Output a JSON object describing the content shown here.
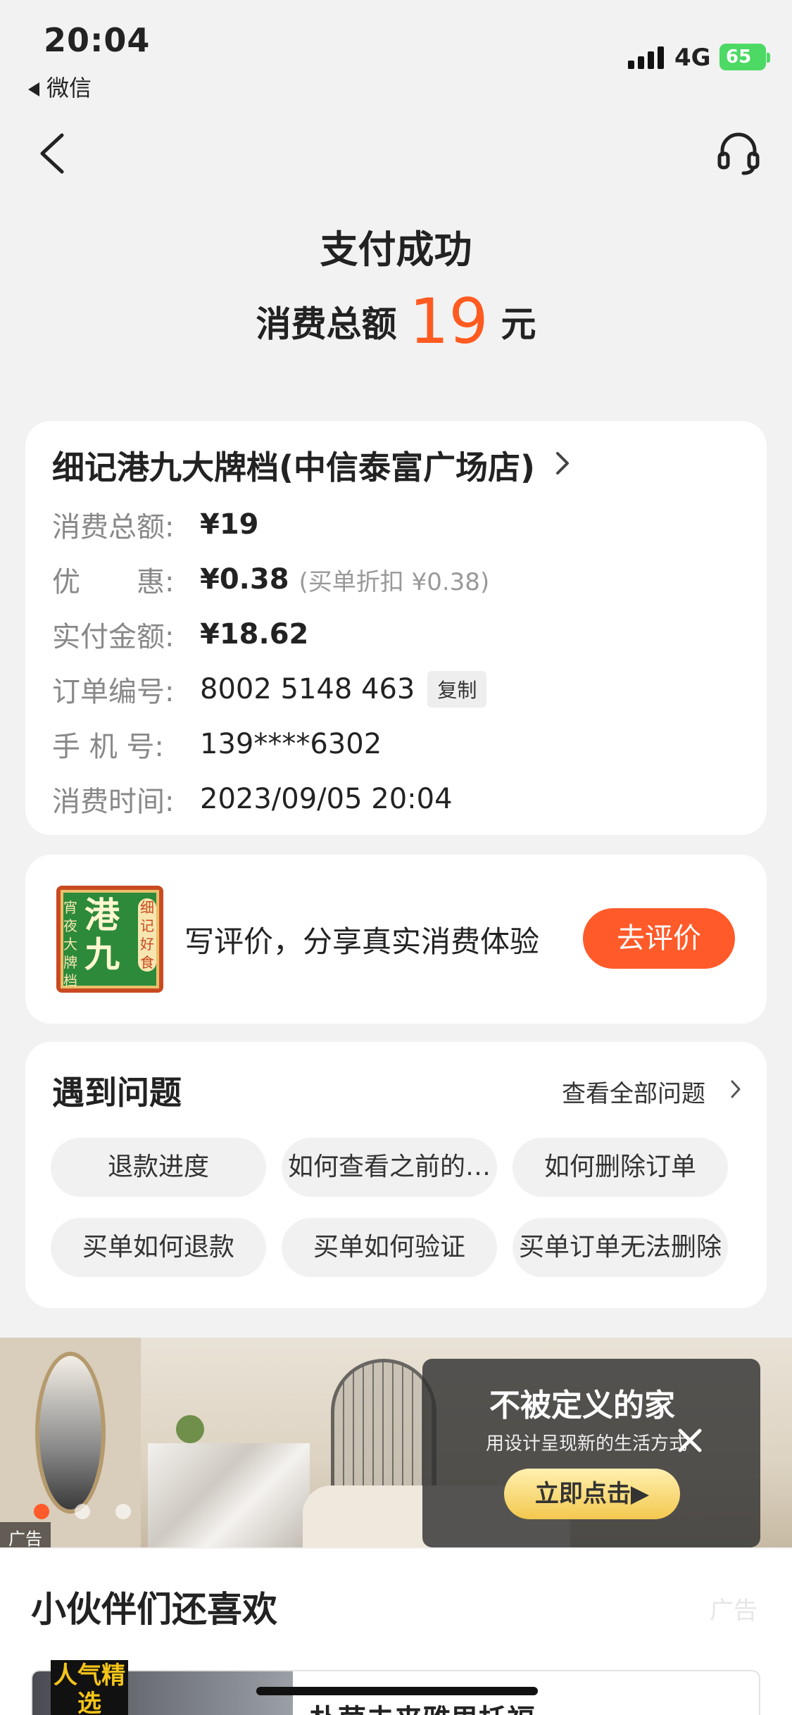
{
  "status_bar": {
    "time": "20:04",
    "back_app": "微信",
    "network": "4G",
    "battery": "65"
  },
  "header": {
    "title": "支付成功",
    "total_label": "消费总额",
    "total_amount": "19",
    "total_unit": "元"
  },
  "order": {
    "shop_name": "细记港九大牌档(中信泰富广场店)",
    "rows": [
      {
        "key": "消费总额:",
        "value": "¥19"
      },
      {
        "key": "优　　惠:",
        "value": "¥0.38",
        "note": "(买单折扣 ¥0.38)"
      },
      {
        "key": "实付金额:",
        "value": "¥18.62"
      },
      {
        "key": "订单编号:",
        "value": "8002 5148 463",
        "action": "复制"
      },
      {
        "key": "手 机 号:",
        "value": "139****6302"
      },
      {
        "key": "消费时间:",
        "value": "2023/09/05 20:04"
      }
    ]
  },
  "review": {
    "logo_text": "港九",
    "logo_side_left": "宵夜大牌档",
    "logo_side_right": "细记好食",
    "prompt": "写评价，分享真实消费体验",
    "button": "去评价"
  },
  "faq": {
    "title": "遇到问题",
    "view_all": "查看全部问题",
    "chips": [
      "退款进度",
      "如何查看之前的…",
      "如何删除订单",
      "买单如何退款",
      "买单如何验证",
      "买单订单无法删除"
    ]
  },
  "ad": {
    "headline": "不被定义的家",
    "subline": "用设计呈现新的生活方式",
    "cta": "立即点击▶",
    "tag": "广告",
    "active_slide": 1,
    "slide_count": 3
  },
  "recommend": {
    "title": "小伙伴们还喜欢",
    "ad_label": "广告",
    "badge": "人气精选",
    "item_name": "朴茵未来雅思托福"
  },
  "colors": {
    "accent": "#ff5a1f",
    "button": "#ff5a2a",
    "battery": "#4cd964"
  }
}
